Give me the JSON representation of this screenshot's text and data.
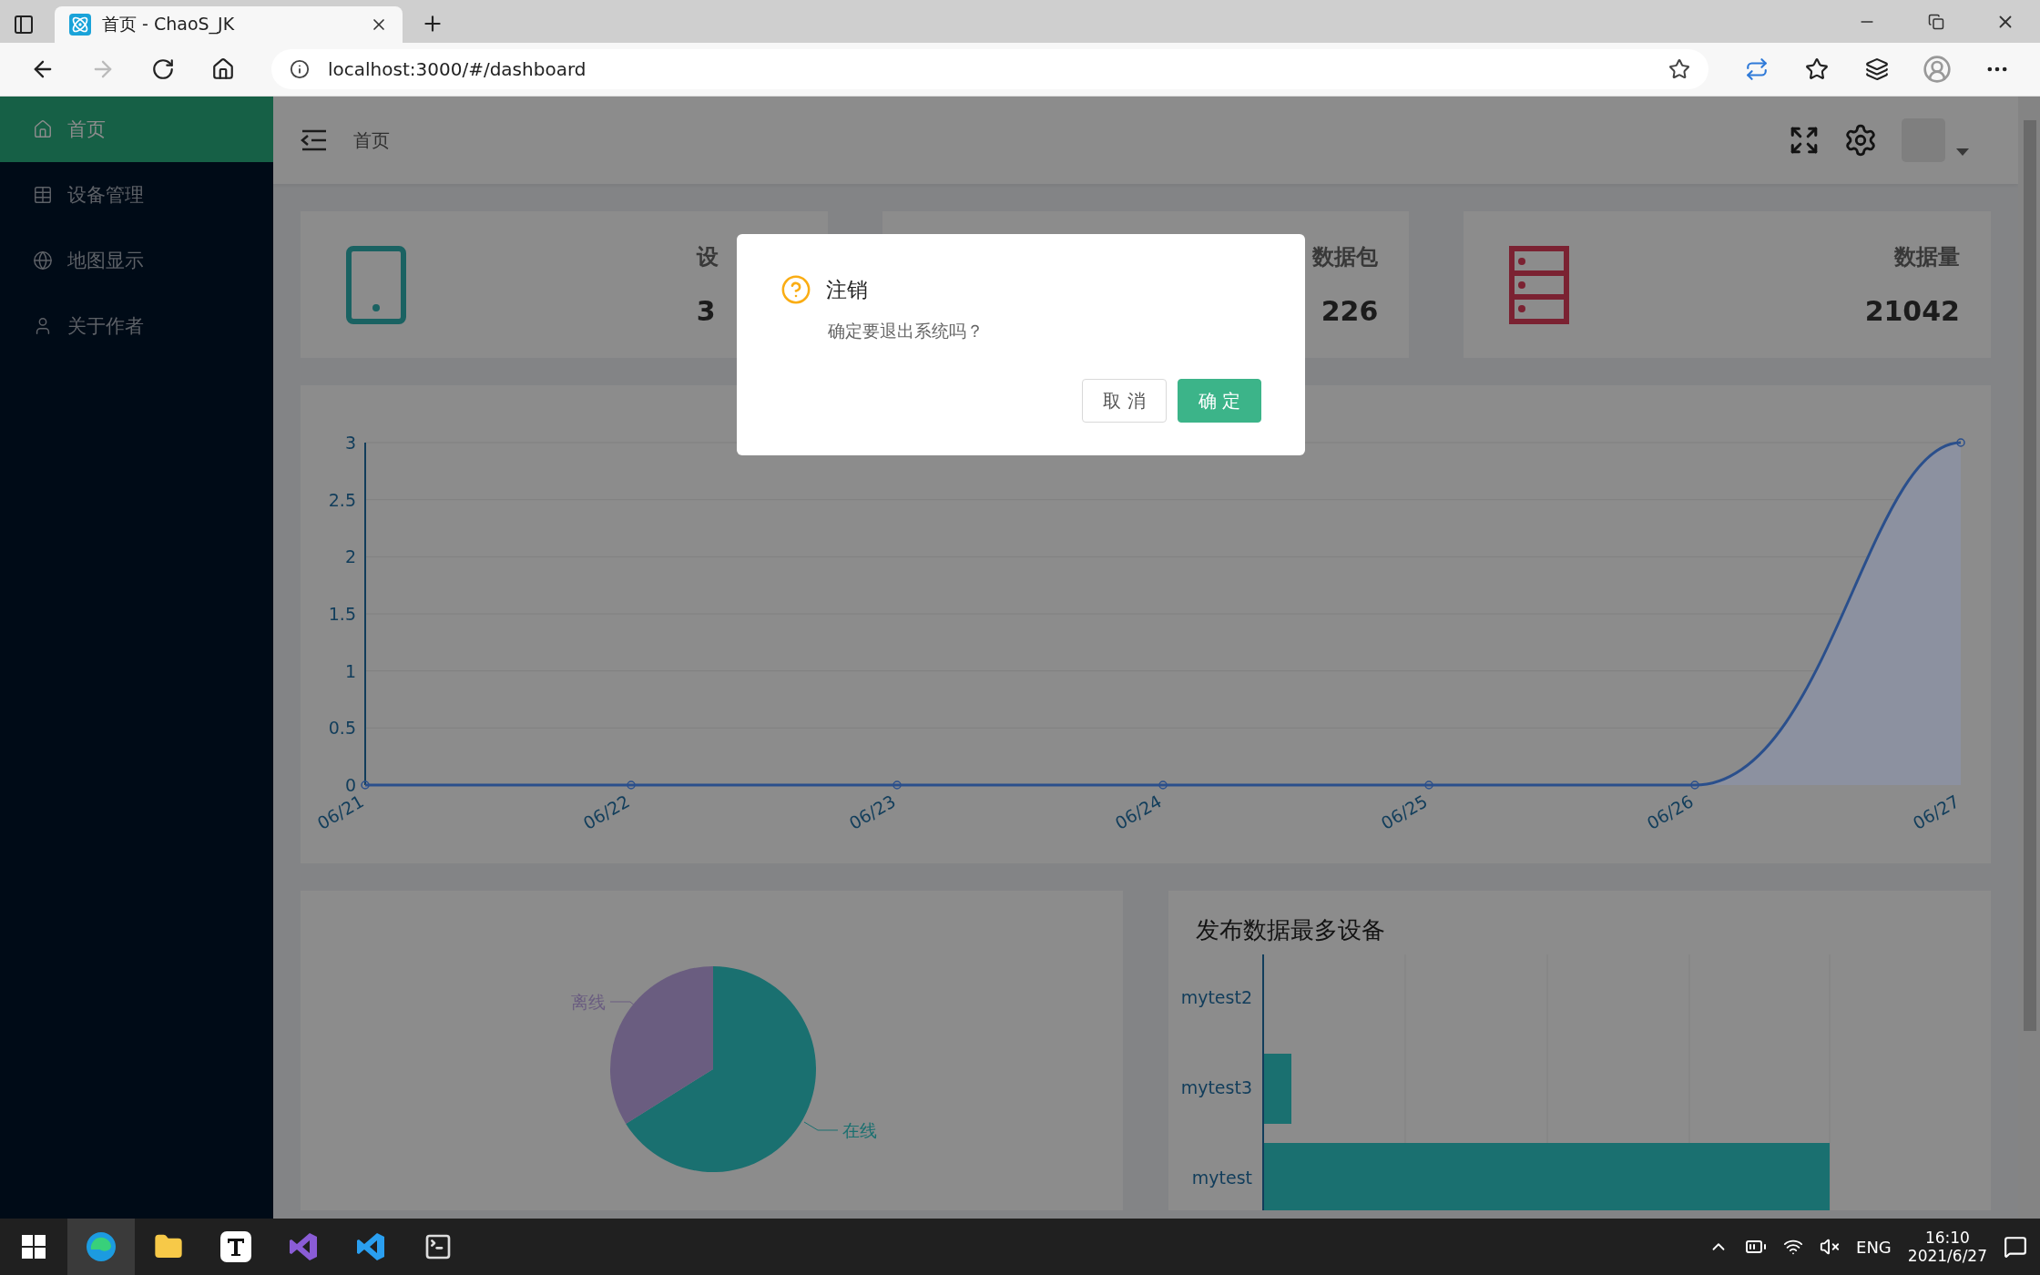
{
  "browser": {
    "tab_title": "首页 - ChaoS_JK",
    "url": "localhost:3000/#/dashboard"
  },
  "sidebar": {
    "items": [
      {
        "label": "首页",
        "selected": true
      },
      {
        "label": "设备管理",
        "selected": false
      },
      {
        "label": "地图显示",
        "selected": false
      },
      {
        "label": "关于作者",
        "selected": false
      }
    ]
  },
  "header": {
    "breadcrumb": "首页"
  },
  "stat_cards": [
    {
      "title": "设",
      "value": "3"
    },
    {
      "title": "数据包",
      "value": "226"
    },
    {
      "title": "数据量",
      "value": "21042"
    }
  ],
  "line_chart": {
    "chart_data": {
      "type": "line",
      "categories": [
        "06/21",
        "06/22",
        "06/23",
        "06/24",
        "06/25",
        "06/26",
        "06/27"
      ],
      "ylim": [
        0,
        3
      ],
      "grid": true,
      "yticks": [
        0,
        0.5,
        1,
        1.5,
        2,
        2.5,
        3
      ],
      "series": [
        {
          "color": "#2a4f8c",
          "marker": true,
          "values": [
            0,
            0,
            0,
            0,
            0,
            0,
            3
          ]
        }
      ]
    }
  },
  "pie": {
    "labels": [
      {
        "text": "离线",
        "color": "#6a5d80"
      },
      {
        "text": "在线",
        "color": "#1a7070"
      }
    ]
  },
  "bar_panel": {
    "title": "发布数据最多设备",
    "categories": [
      "mytest2",
      "mytest3",
      "mytest"
    ]
  },
  "modal": {
    "title": "注销",
    "message": "确定要退出系统吗？",
    "cancel": "取 消",
    "ok": "确 定"
  },
  "taskbar": {
    "language": "ENG",
    "time": "16:10",
    "date": "2021/6/27"
  }
}
